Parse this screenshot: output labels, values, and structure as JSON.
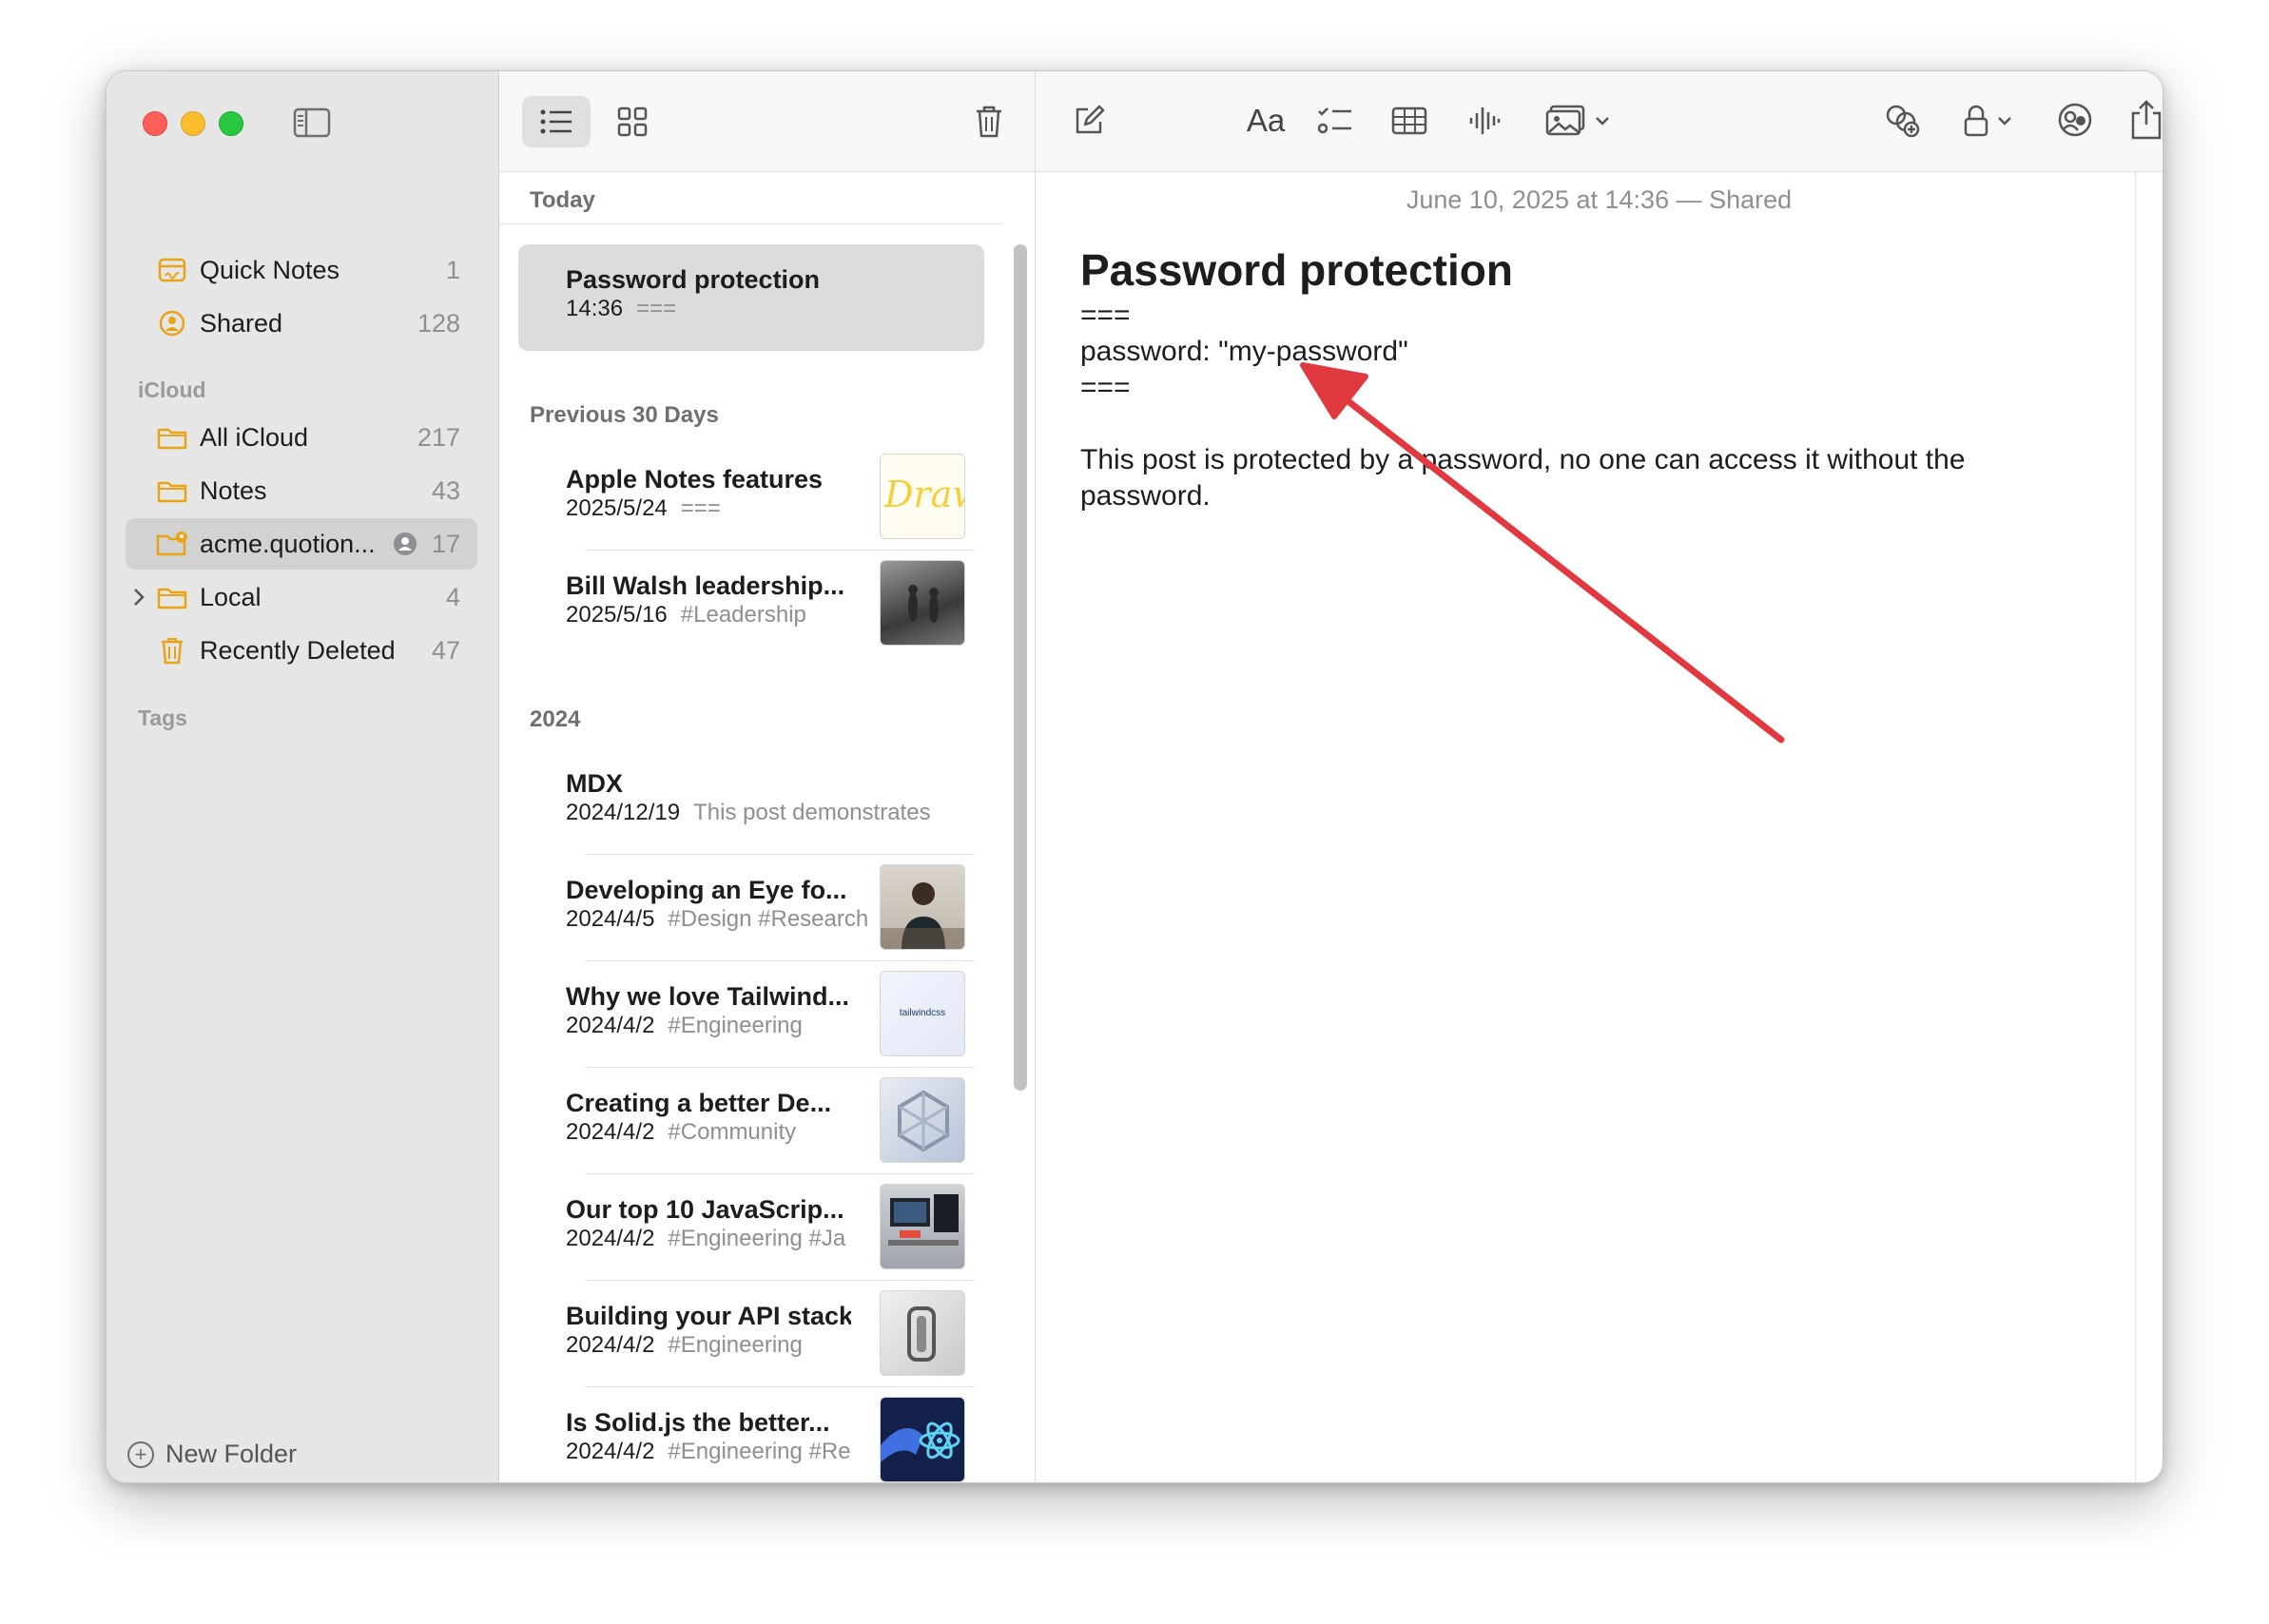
{
  "sidebar": {
    "pinned": [
      {
        "label": "Quick Notes",
        "count": "1",
        "icon": "quick-notes-icon"
      },
      {
        "label": "Shared",
        "count": "128",
        "icon": "shared-person-icon"
      }
    ],
    "icloud_header": "iCloud",
    "folders": [
      {
        "label": "All iCloud",
        "count": "217",
        "icon": "folder-icon"
      },
      {
        "label": "Notes",
        "count": "43",
        "icon": "folder-icon"
      },
      {
        "label": "acme.quotion...",
        "count": "17",
        "icon": "shared-folder-icon",
        "selected": true
      },
      {
        "label": "Local",
        "count": "4",
        "icon": "folder-icon"
      },
      {
        "label": "Recently Deleted",
        "count": "47",
        "icon": "trash-icon"
      }
    ],
    "tags_header": "Tags",
    "new_folder": "New Folder"
  },
  "list": {
    "sections": {
      "today": "Today",
      "previous": "Previous 30 Days",
      "year": "2024"
    },
    "notes": [
      {
        "title": "Password protection",
        "date": "14:36",
        "snippet": "===",
        "selected": true
      },
      {
        "title": "Apple Notes features",
        "date": "2025/5/24",
        "snippet": "==="
      },
      {
        "title": "Bill Walsh leadership...",
        "date": "2025/5/16",
        "snippet": "#Leadership"
      },
      {
        "title": "MDX",
        "date": "2024/12/19",
        "snippet": "This post demonstrates"
      },
      {
        "title": "Developing an Eye fo...",
        "date": "2024/4/5",
        "snippet": "#Design #Research"
      },
      {
        "title": "Why we love Tailwind...",
        "date": "2024/4/2",
        "snippet": "#Engineering"
      },
      {
        "title": "Creating a better De...",
        "date": "2024/4/2",
        "snippet": "#Community"
      },
      {
        "title": "Our top 10 JavaScrip...",
        "date": "2024/4/2",
        "snippet": "#Engineering #Ja"
      },
      {
        "title": "Building your API stack",
        "date": "2024/4/2",
        "snippet": "#Engineering"
      },
      {
        "title": "Is Solid.js the better...",
        "date": "2024/4/2",
        "snippet": "#Engineering #Re"
      }
    ],
    "thumb_text": {
      "drawing": "Drawin",
      "tailwind": "tailwindcss"
    }
  },
  "editor": {
    "date_line": "June 10, 2025 at 14:36 — Shared",
    "title": "Password protection",
    "line1": "===",
    "line2": "password: \"my-password\"",
    "line3": "===",
    "paragraph": "This post is protected by a password, no one can access it without the password.",
    "toolbar": {
      "format_label": "Aa"
    }
  },
  "colors": {
    "accent_folder": "#e8a317",
    "annotation_arrow": "#e0393f"
  }
}
